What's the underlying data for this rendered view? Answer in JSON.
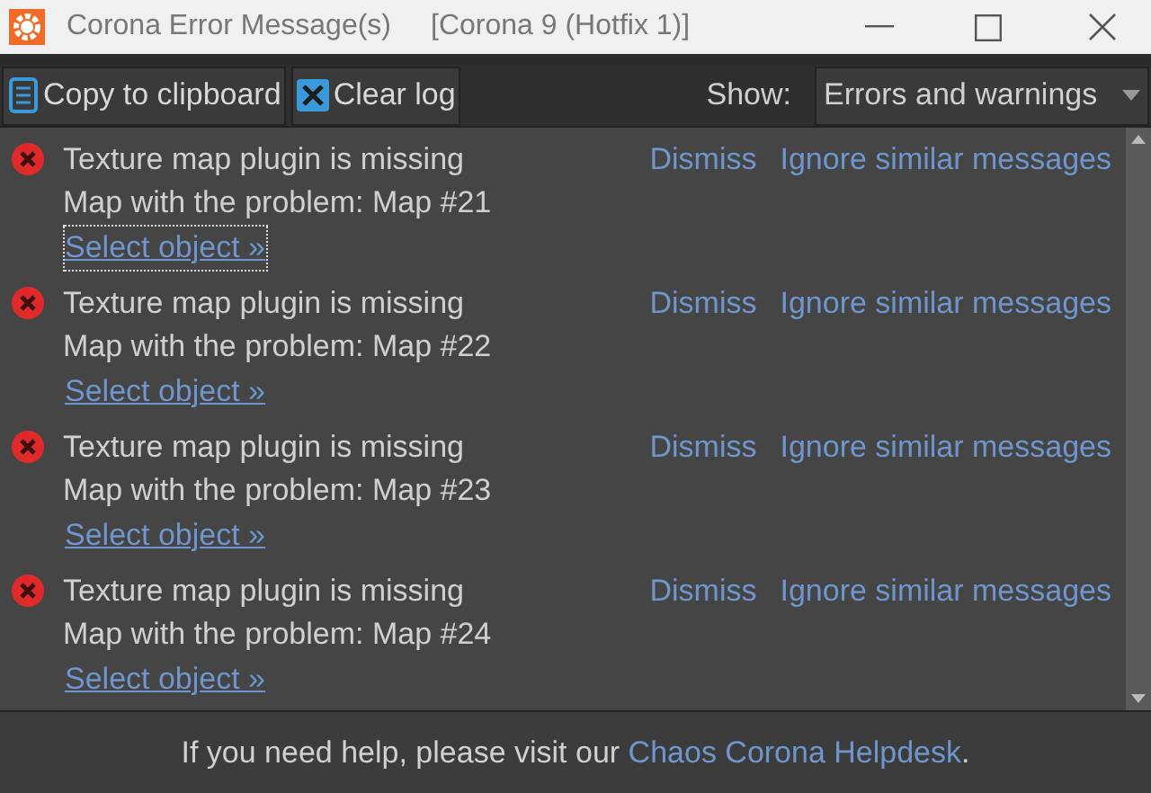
{
  "window": {
    "title": "Corona Error Message(s)",
    "subtitle": "[Corona 9 (Hotfix 1)]"
  },
  "toolbar": {
    "buttons": [
      {
        "kind": "copy",
        "label": "Copy to clipboard"
      },
      {
        "kind": "clear",
        "label": "Clear log"
      }
    ],
    "show_label": "Show:",
    "show_value": "Errors and warnings"
  },
  "messages": [
    {
      "title": "Texture map plugin is missing",
      "detail": "Map with the problem: Map #21",
      "link": "Select object »",
      "focused": true,
      "dismiss": "Dismiss",
      "ignore": "Ignore similar messages"
    },
    {
      "title": "Texture map plugin is missing",
      "detail": "Map with the problem: Map #22",
      "link": "Select object »",
      "focused": false,
      "dismiss": "Dismiss",
      "ignore": "Ignore similar messages"
    },
    {
      "title": "Texture map plugin is missing",
      "detail": "Map with the problem: Map #23",
      "link": "Select object »",
      "focused": false,
      "dismiss": "Dismiss",
      "ignore": "Ignore similar messages"
    },
    {
      "title": "Texture map plugin is missing",
      "detail": "Map with the problem: Map #24",
      "link": "Select object »",
      "focused": false,
      "dismiss": "Dismiss",
      "ignore": "Ignore similar messages"
    }
  ],
  "footer": {
    "text": "If you need help, please visit our",
    "link": "Chaos Corona Helpdesk",
    "end": "."
  }
}
